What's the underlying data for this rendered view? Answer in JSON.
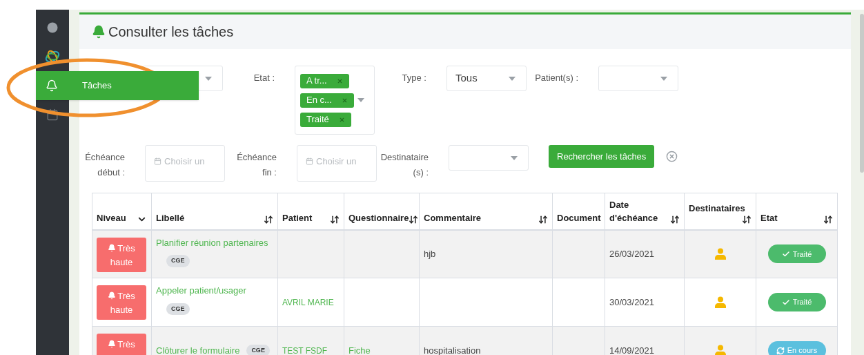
{
  "sidebar": {
    "items": [
      {
        "selected": false
      },
      {
        "selected": false
      },
      {
        "label": "Tâches",
        "selected": true
      },
      {
        "selected": false
      }
    ]
  },
  "page": {
    "title": "Consulter les tâches"
  },
  "filters": [
    [
      {
        "kind": "select"
      },
      {
        "kind": "tags",
        "label": "Etat :",
        "tags": [
          "A tr...",
          "En c...",
          "Traité"
        ]
      },
      {
        "kind": "select",
        "label": "Type :",
        "value": "Tous"
      },
      {
        "kind": "select",
        "label": "Patient(s) :"
      }
    ],
    [
      {
        "kind": "date",
        "label": "Échéance début :",
        "placeholder": "Choisir un"
      },
      {
        "kind": "date",
        "label": "Échéance fin :",
        "placeholder": "Choisir un"
      },
      {
        "kind": "select",
        "label": "Destinataire(s) :"
      }
    ]
  ],
  "search_button": "Rechercher les tâches",
  "table": {
    "columns": [
      {
        "label": "Niveau"
      },
      {
        "label": "Libellé"
      },
      {
        "label": "Patient"
      },
      {
        "label": "Questionnaire"
      },
      {
        "label": "Commentaire"
      },
      {
        "label": "Document"
      },
      {
        "label": "Date d'échéance"
      },
      {
        "label": "Destinataires"
      },
      {
        "label": "Etat"
      }
    ],
    "rows": [
      {
        "niveau": "Très haute",
        "libelle": "Planifier réunion partenaires",
        "tag": "CGE",
        "tag_inline": false,
        "patient": "",
        "questionnaire": "",
        "commentaire": "hjb",
        "date": "26/03/2021",
        "etat": {
          "label": "Traité",
          "kind": "done"
        }
      },
      {
        "niveau": "Très haute",
        "libelle": "Appeler patient/usager",
        "tag": "CGE",
        "tag_inline": false,
        "patient": "AVRIL MARIE",
        "questionnaire": "",
        "commentaire": "",
        "date": "30/03/2021",
        "etat": {
          "label": "Traité",
          "kind": "done"
        }
      },
      {
        "niveau": "Très",
        "libelle": "Clôturer le formulaire",
        "tag": "CGE",
        "tag_inline": true,
        "patient": "TEST FSDF",
        "questionnaire": "Fiche",
        "commentaire": "hospitalisation",
        "date": "14/09/2021",
        "etat": {
          "label": "En cours",
          "kind": "progress"
        }
      }
    ]
  }
}
